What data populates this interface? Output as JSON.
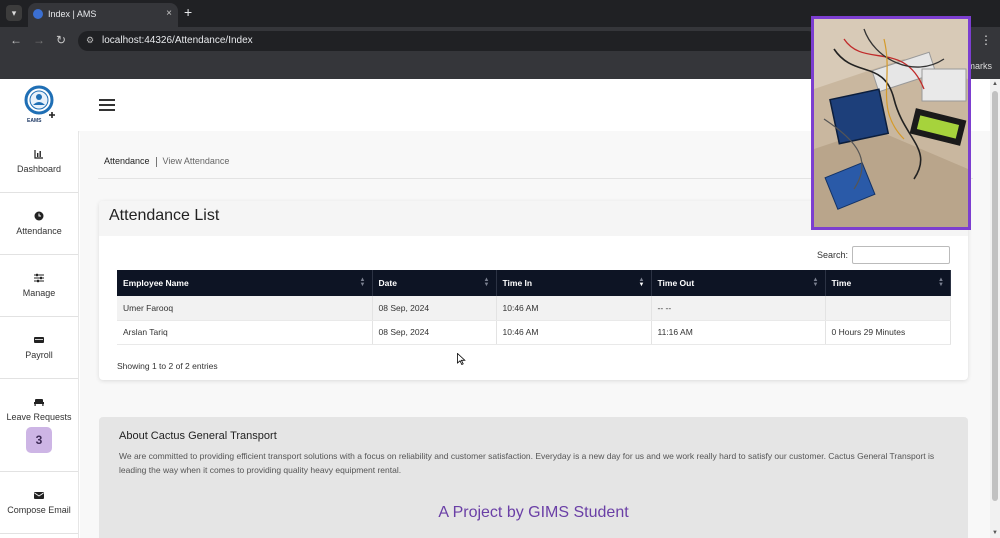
{
  "browser": {
    "tab_title": "Index | AMS",
    "tab_close": "×",
    "new_tab": "+",
    "url": "localhost:44326/Attendance/Index",
    "bookmarks_label": "marks"
  },
  "app": {
    "logo_text": "EAMS",
    "sidebar": [
      {
        "label": "Dashboard",
        "icon": "bar-chart-icon"
      },
      {
        "label": "Attendance",
        "icon": "clock-icon"
      },
      {
        "label": "Manage",
        "icon": "sliders-icon"
      },
      {
        "label": "Payroll",
        "icon": "money-icon"
      },
      {
        "label": "Leave Requests",
        "icon": "bed-icon",
        "badge": "3"
      },
      {
        "label": "Compose Email",
        "icon": "envelope-icon"
      }
    ],
    "breadcrumb": {
      "parent": "Attendance",
      "current": "View Attendance"
    }
  },
  "attendance": {
    "title": "Attendance List",
    "search_label": "Search:",
    "search_value": "",
    "columns": [
      "Employee Name",
      "Date",
      "Time In",
      "Time Out",
      "Time"
    ],
    "rows": [
      [
        "Umer Farooq",
        "08 Sep, 2024",
        "10:46 AM",
        "-- --",
        ""
      ],
      [
        "Arslan Tariq",
        "08 Sep, 2024",
        "10:46 AM",
        "11:16 AM",
        "0 Hours 29 Minutes"
      ]
    ],
    "info": "Showing 1 to 2 of 2 entries"
  },
  "about": {
    "title": "About Cactus General Transport",
    "text": "We are committed to providing efficient transport solutions with a focus on reliability and customer satisfaction. Everyday is a new day for us and we work really hard to satisfy our customer. Cactus General Transport is leading the way when it comes to providing quality heavy equipment rental.",
    "project": "A Project by GIMS Student"
  },
  "colors": {
    "table_header": "#0d1424",
    "badge_bg": "#cdb5e5",
    "project_text": "#6a3fa6",
    "overlay_border": "#7c3ed0"
  }
}
